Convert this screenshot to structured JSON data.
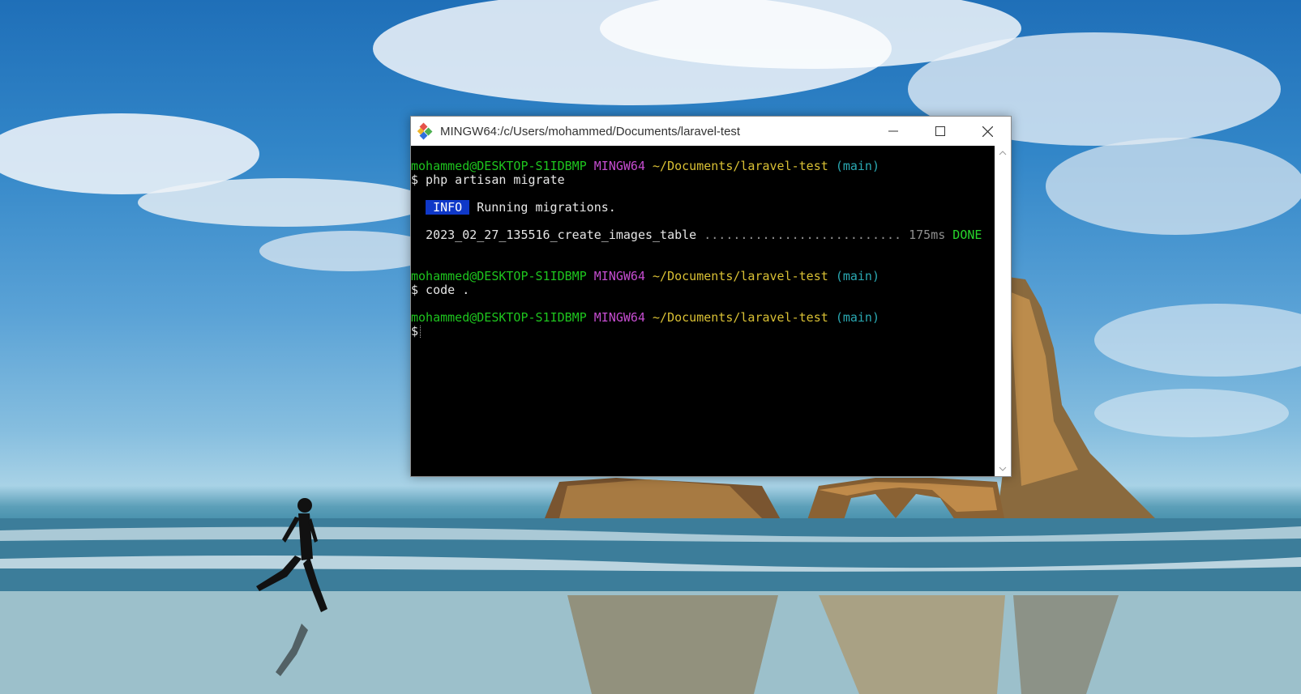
{
  "window": {
    "title": "MINGW64:/c/Users/mohammed/Documents/laravel-test",
    "app_icon": "git-bash-icon",
    "controls": [
      "minimize-icon",
      "maximize-icon",
      "close-icon"
    ]
  },
  "terminal": {
    "prompt1": {
      "user": "mohammed@DESKTOP-S1IDBMP",
      "env": "MINGW64",
      "path": "~/Documents/laravel-test",
      "branch": "(main)"
    },
    "cmd1": "$ php artisan migrate",
    "info_badge": "INFO",
    "info_text": "Running migrations.",
    "migration_name": "2023_02_27_135516_create_images_table",
    "migration_dots": "...........................",
    "migration_time": "175ms",
    "migration_status": "DONE",
    "prompt2": {
      "user": "mohammed@DESKTOP-S1IDBMP",
      "env": "MINGW64",
      "path": "~/Documents/laravel-test",
      "branch": "(main)"
    },
    "cmd2": "$ code .",
    "prompt3": {
      "user": "mohammed@DESKTOP-S1IDBMP",
      "env": "MINGW64",
      "path": "~/Documents/laravel-test",
      "branch": "(main)"
    },
    "cmd3": "$"
  },
  "colors": {
    "prompt_user": "#1ec51e",
    "prompt_env": "#c64dd1",
    "prompt_path": "#d9c034",
    "prompt_branch": "#2aa9b3",
    "info_badge_bg": "#0f38c8",
    "done": "#27d62b"
  }
}
